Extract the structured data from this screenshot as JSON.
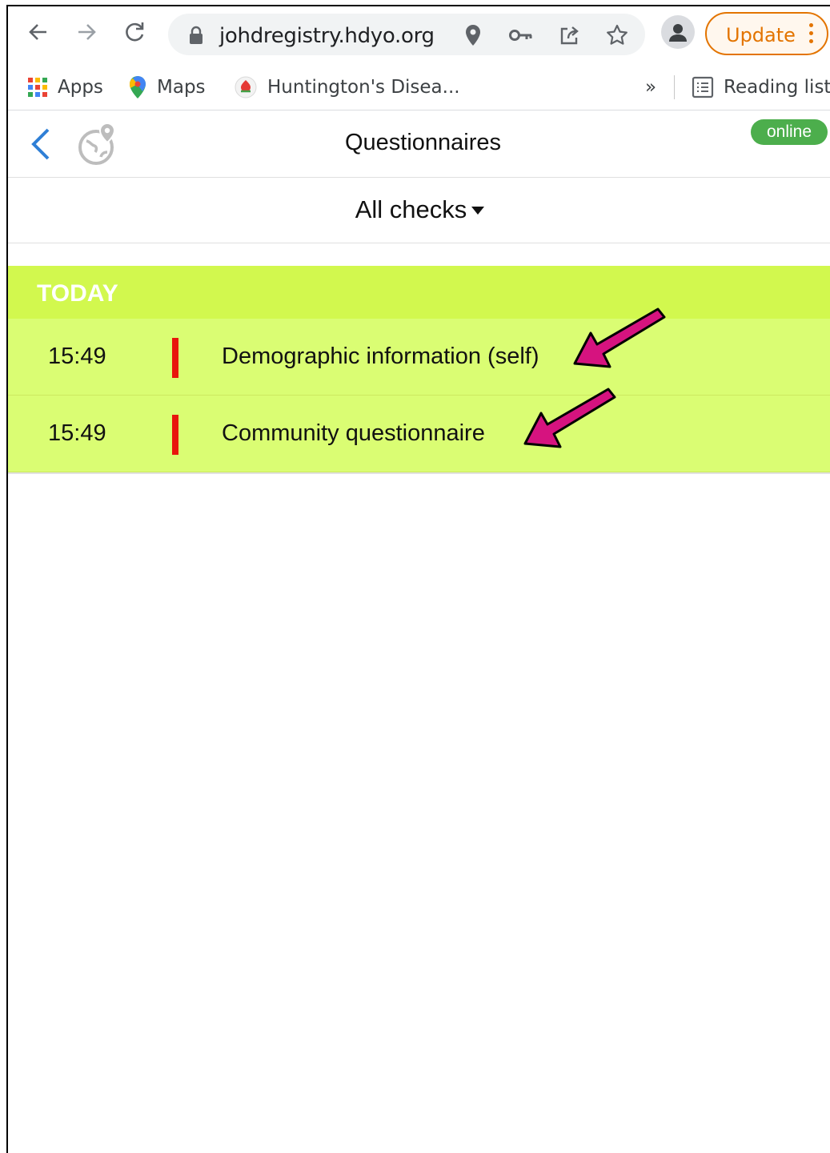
{
  "browser": {
    "url": "johdregistry.hdyo.org",
    "update_label": "Update",
    "bookmarks": [
      {
        "label": "Apps",
        "icon": "apps-grid-icon"
      },
      {
        "label": "Maps",
        "icon": "maps-pin-icon"
      },
      {
        "label": "Huntington's Disea...",
        "icon": "hd-favicon-icon"
      }
    ],
    "overflow_label": "»",
    "reading_list_label": "Reading list"
  },
  "app": {
    "title": "Questionnaires",
    "status": "online",
    "filter_label": "All checks"
  },
  "section": {
    "label": "TODAY",
    "items": [
      {
        "time": "15:49",
        "title": "Demographic information (self)"
      },
      {
        "time": "15:49",
        "title": "Community questionnaire"
      }
    ]
  },
  "colors": {
    "section_header": "#d2f84e",
    "row_background": "#dafd73",
    "status_marker": "#e8160c",
    "online_badge": "#4cae4c",
    "annotation_arrow": "#d6137f",
    "back_chevron": "#2f7fd6",
    "update_accent": "#e37400"
  }
}
